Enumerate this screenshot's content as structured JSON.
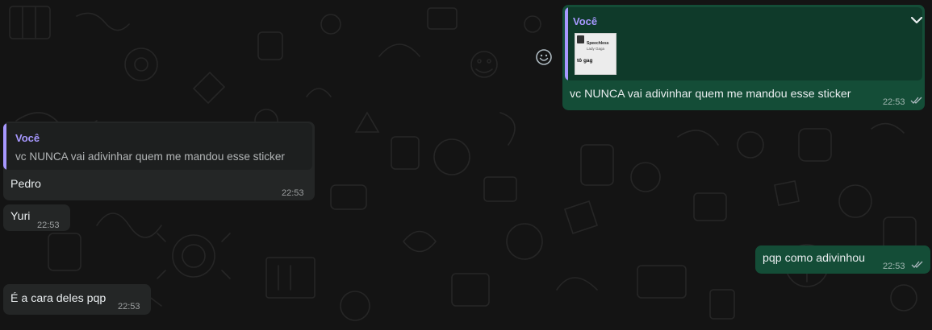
{
  "colors": {
    "incoming_bubble": "#242626",
    "outgoing_bubble": "#144d37",
    "quote_accent": "#a798ff",
    "read_ticks": "#aebac1"
  },
  "messages": [
    {
      "direction": "outgoing",
      "quote": {
        "author": "Você",
        "sticker": {
          "title": "Speechless",
          "subtitle": "Lady Gaga",
          "caption": "tô gag"
        }
      },
      "text": "vc NUNCA vai adivinhar quem me mandou esse sticker",
      "time": "22:53",
      "status": "read"
    },
    {
      "direction": "incoming",
      "quote": {
        "author": "Você",
        "text": "vc NUNCA vai adivinhar quem me mandou esse sticker"
      },
      "text": "Pedro",
      "time": "22:53"
    },
    {
      "direction": "incoming",
      "text": "Yuri",
      "time": "22:53"
    },
    {
      "direction": "outgoing",
      "text": "pqp como adivinhou",
      "time": "22:53",
      "status": "read"
    },
    {
      "direction": "incoming",
      "text": "É a cara deles pqp",
      "time": "22:53"
    }
  ],
  "icons": {
    "react": "smiley-icon",
    "menu": "chevron-down-icon",
    "status": "double-check-icon"
  }
}
